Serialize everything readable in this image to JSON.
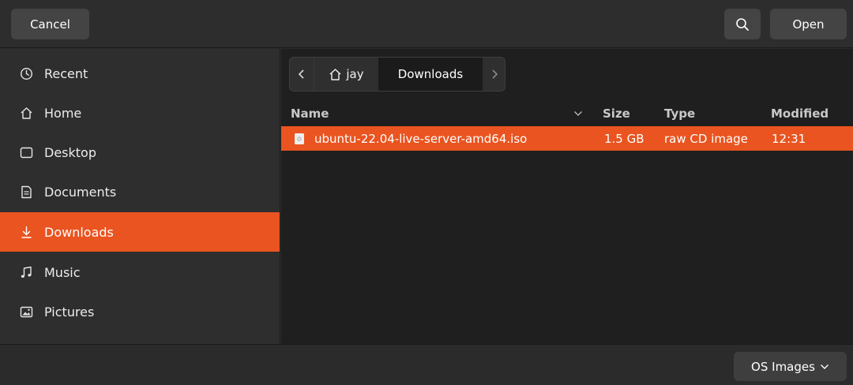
{
  "header": {
    "cancel_label": "Cancel",
    "search_icon": "search-icon",
    "open_label": "Open"
  },
  "sidebar": {
    "items": [
      {
        "label": "Recent",
        "icon": "clock-icon"
      },
      {
        "label": "Home",
        "icon": "home-icon"
      },
      {
        "label": "Desktop",
        "icon": "desktop-icon"
      },
      {
        "label": "Documents",
        "icon": "document-icon"
      },
      {
        "label": "Downloads",
        "icon": "download-icon",
        "active": true
      },
      {
        "label": "Music",
        "icon": "music-icon"
      },
      {
        "label": "Pictures",
        "icon": "pictures-icon"
      }
    ]
  },
  "pathbar": {
    "home_label": "jay",
    "current_label": "Downloads"
  },
  "columns": {
    "name": "Name",
    "size": "Size",
    "type": "Type",
    "modified": "Modified"
  },
  "files": [
    {
      "name": "ubuntu-22.04-live-server-amd64.iso",
      "size": "1.5 GB",
      "type": "raw CD image",
      "modified": "12:31",
      "selected": true
    }
  ],
  "footer": {
    "filter_label": "OS Images"
  },
  "colors": {
    "accent": "#e95420",
    "background": "#2b2b2b",
    "list_background": "#1f1f1f"
  }
}
